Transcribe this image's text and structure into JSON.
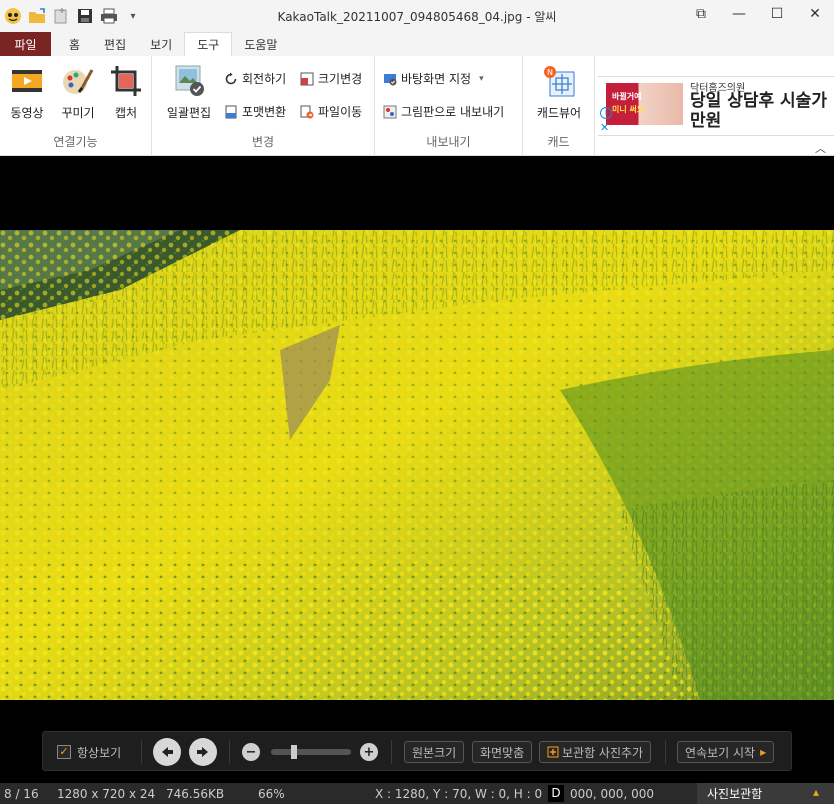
{
  "window": {
    "title": "KakaoTalk_20211007_094805468_04.jpg - 알씨",
    "controls": {
      "restore": "⧉",
      "minimize": "—",
      "maximize": "☐",
      "close": "✕"
    }
  },
  "qat": {
    "dropdown": "▾"
  },
  "tabs": [
    {
      "label": "파일"
    },
    {
      "label": "홈"
    },
    {
      "label": "편집"
    },
    {
      "label": "보기"
    },
    {
      "label": "도구"
    },
    {
      "label": "도움말"
    }
  ],
  "ribbon": {
    "connect": {
      "label": "연결기능",
      "video": "동영상",
      "decorate": "꾸미기",
      "capture": "캡처"
    },
    "change": {
      "label": "변경",
      "batch": "일괄편집",
      "rotate": "회전하기",
      "resize": "크기변경",
      "format": "포맷변환",
      "move": "파일이동"
    },
    "export": {
      "label": "내보내기",
      "wallpaper": "바탕화면 지정",
      "wallpaper_arrow": "▾",
      "clipboard": "그림판으로 내보내기"
    },
    "card": {
      "label": "캐드",
      "viewer": "캐드뷰어"
    },
    "collapse": "︿"
  },
  "ad": {
    "small": "닥터홈즈의원",
    "big": "당일 상담후 시술가 만원",
    "thumb_line1": "바뀔거예",
    "thumb_line2": "미니 써요",
    "info": "i",
    "close": "✕"
  },
  "navbar": {
    "always_view": "항상보기",
    "checkmark": "✓",
    "prev": "◀",
    "next": "▶",
    "zoom_out": "−",
    "zoom_in": "+",
    "original_size": "원본크기",
    "fit_screen": "화면맞춤",
    "add_to_album": "보관함 사진추가",
    "slideshow": "연속보기 시작",
    "slideshow_arrow": "▸"
  },
  "status": {
    "position": "8 / 16",
    "dimensions": "1280 x 720 x 24",
    "filesize": "746.56KB",
    "zoom": "66%",
    "coords": "X : 1280, Y : 70, W : 0, H : 0",
    "d_label": "D",
    "color": "000, 000, 000",
    "album": "사진보관함",
    "album_arrow": "▴"
  },
  "colors": {
    "file_tab": "#7a2424",
    "accent": "#f0a020",
    "flower_yellow": "#f0e020",
    "grass_green": "#4a8a20"
  }
}
